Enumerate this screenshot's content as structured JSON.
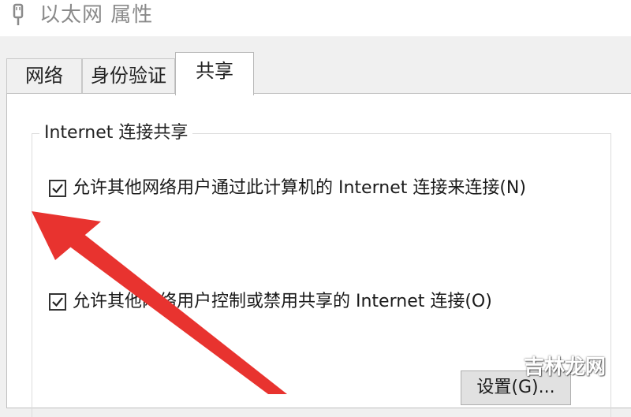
{
  "window": {
    "title": "以太网 属性",
    "icon": "network-adapter-icon"
  },
  "tabs": [
    {
      "label": "网络",
      "active": false
    },
    {
      "label": "身份验证",
      "active": false
    },
    {
      "label": "共享",
      "active": true
    }
  ],
  "sharing": {
    "group_title": "Internet 连接共享",
    "options": [
      {
        "label": "允许其他网络用户通过此计算机的 Internet 连接来连接(N)",
        "checked": true
      },
      {
        "label": "允许其他网络用户控制或禁用共享的 Internet 连接(O)",
        "checked": true
      }
    ],
    "settings_button": "设置(G)..."
  },
  "annotation": {
    "arrow_color": "#e8332f",
    "arrow_points_to": "first-checkbox"
  },
  "watermark": {
    "text": "吉林龙网"
  }
}
